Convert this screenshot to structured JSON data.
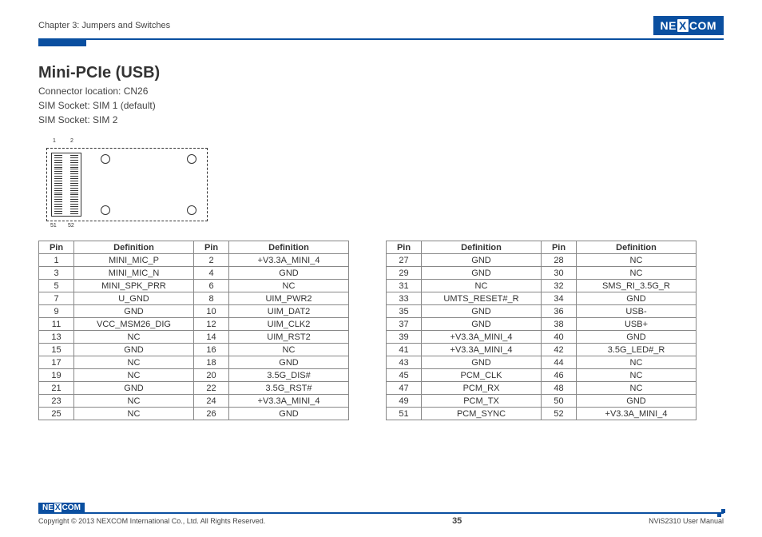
{
  "header": {
    "chapter": "Chapter 3: Jumpers and Switches",
    "logo_text": "NEXCOM"
  },
  "section": {
    "title": "Mini-PCIe (USB)",
    "lines": [
      "Connector location: CN26",
      "SIM Socket: SIM 1 (default)",
      "SIM Socket: SIM 2"
    ]
  },
  "diagram": {
    "labels": {
      "tl": "1",
      "tr": "2",
      "bl": "51",
      "br": "52"
    }
  },
  "table_headers": [
    "Pin",
    "Definition",
    "Pin",
    "Definition"
  ],
  "table_left": [
    [
      "1",
      "MINI_MIC_P",
      "2",
      "+V3.3A_MINI_4"
    ],
    [
      "3",
      "MINI_MIC_N",
      "4",
      "GND"
    ],
    [
      "5",
      "MINI_SPK_PRR",
      "6",
      "NC"
    ],
    [
      "7",
      "U_GND",
      "8",
      "UIM_PWR2"
    ],
    [
      "9",
      "GND",
      "10",
      "UIM_DAT2"
    ],
    [
      "11",
      "VCC_MSM26_DIG",
      "12",
      "UIM_CLK2"
    ],
    [
      "13",
      "NC",
      "14",
      "UIM_RST2"
    ],
    [
      "15",
      "GND",
      "16",
      "NC"
    ],
    [
      "17",
      "NC",
      "18",
      "GND"
    ],
    [
      "19",
      "NC",
      "20",
      "3.5G_DIS#"
    ],
    [
      "21",
      "GND",
      "22",
      "3.5G_RST#"
    ],
    [
      "23",
      "NC",
      "24",
      "+V3.3A_MINI_4"
    ],
    [
      "25",
      "NC",
      "26",
      "GND"
    ]
  ],
  "table_right": [
    [
      "27",
      "GND",
      "28",
      "NC"
    ],
    [
      "29",
      "GND",
      "30",
      "NC"
    ],
    [
      "31",
      "NC",
      "32",
      "SMS_RI_3.5G_R"
    ],
    [
      "33",
      "UMTS_RESET#_R",
      "34",
      "GND"
    ],
    [
      "35",
      "GND",
      "36",
      "USB-"
    ],
    [
      "37",
      "GND",
      "38",
      "USB+"
    ],
    [
      "39",
      "+V3.3A_MINI_4",
      "40",
      "GND"
    ],
    [
      "41",
      "+V3.3A_MINI_4",
      "42",
      "3.5G_LED#_R"
    ],
    [
      "43",
      "GND",
      "44",
      "NC"
    ],
    [
      "45",
      "PCM_CLK",
      "46",
      "NC"
    ],
    [
      "47",
      "PCM_RX",
      "48",
      "NC"
    ],
    [
      "49",
      "PCM_TX",
      "50",
      "GND"
    ],
    [
      "51",
      "PCM_SYNC",
      "52",
      "+V3.3A_MINI_4"
    ]
  ],
  "footer": {
    "copyright": "Copyright © 2013 NEXCOM International Co., Ltd. All Rights Reserved.",
    "page": "35",
    "doc": "NViS2310 User Manual",
    "logo_text": "NEXCOM"
  }
}
